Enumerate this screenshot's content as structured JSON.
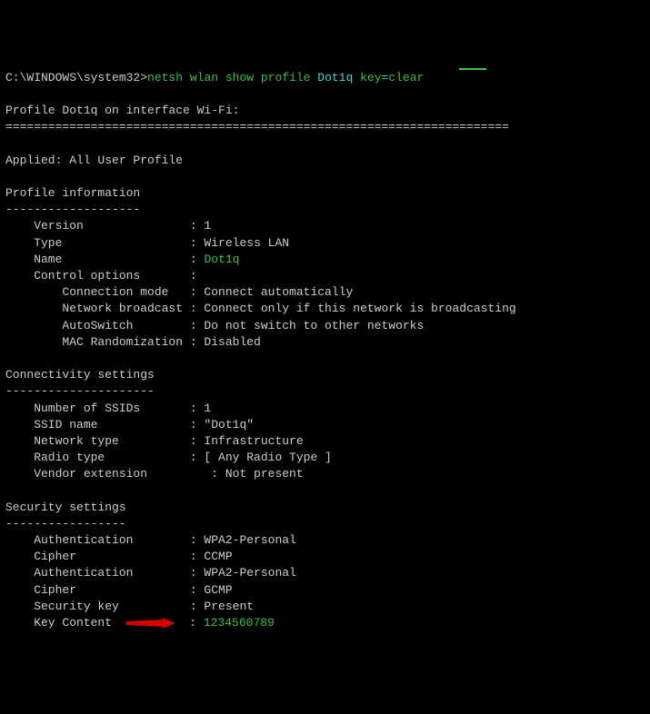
{
  "prompt": {
    "path": "C:\\WINDOWS\\system32>",
    "cmd": "netsh wlan show profile",
    "arg": "Dot1q",
    "opt": "key",
    "eq": "=",
    "val": "clear"
  },
  "header": {
    "title": "Profile Dot1q on interface Wi-Fi:",
    "rule": "======================================================================="
  },
  "applied": "Applied: All User Profile",
  "sections": {
    "profile": {
      "title": "Profile information",
      "rule": "-------------------",
      "rows": [
        {
          "label": "    Version",
          "value": "1"
        },
        {
          "label": "    Type",
          "value": "Wireless LAN"
        },
        {
          "label": "    Name",
          "value": "Dot1q",
          "green": true
        },
        {
          "label": "    Control options",
          "value": ""
        },
        {
          "label": "        Connection mode",
          "value": "Connect automatically"
        },
        {
          "label": "        Network broadcast",
          "value": "Connect only if this network is broadcasting"
        },
        {
          "label": "        AutoSwitch",
          "value": "Do not switch to other networks"
        },
        {
          "label": "        MAC Randomization",
          "value": "Disabled"
        }
      ]
    },
    "connectivity": {
      "title": "Connectivity settings",
      "rule": "---------------------",
      "rows": [
        {
          "label": "    Number of SSIDs",
          "value": "1"
        },
        {
          "label": "    SSID name",
          "value": "\"Dot1q\""
        },
        {
          "label": "    Network type",
          "value": "Infrastructure"
        },
        {
          "label": "    Radio type",
          "value": "[ Any Radio Type ]"
        },
        {
          "label": "    Vendor extension",
          "value": "   : Not present",
          "raw": true
        }
      ]
    },
    "security": {
      "title": "Security settings",
      "rule": "-----------------",
      "rows": [
        {
          "label": "    Authentication",
          "value": "WPA2-Personal"
        },
        {
          "label": "    Cipher",
          "value": "CCMP"
        },
        {
          "label": "    Authentication",
          "value": "WPA2-Personal"
        },
        {
          "label": "    Cipher",
          "value": "GCMP"
        },
        {
          "label": "    Security key",
          "value": "Present"
        },
        {
          "label": "    Key Content",
          "value": "1234560789",
          "green": true,
          "arrow": true
        }
      ]
    }
  },
  "label_width": 26
}
